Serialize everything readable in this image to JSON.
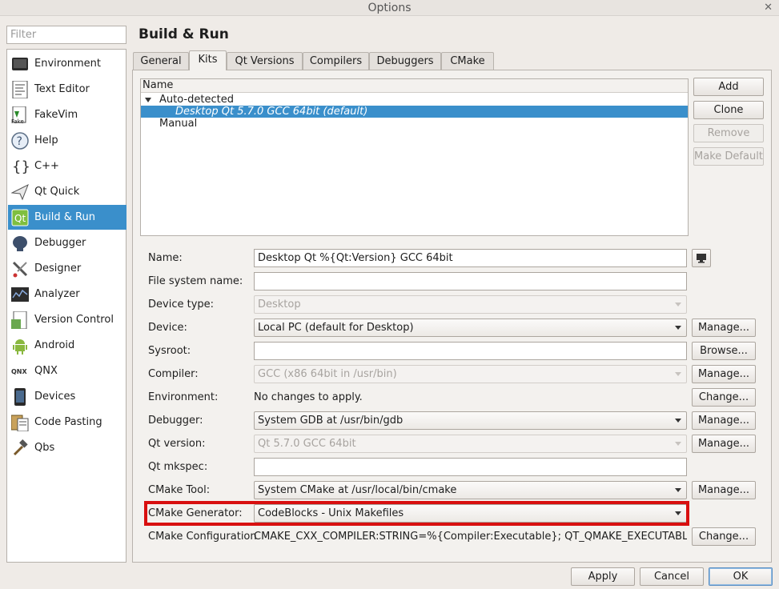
{
  "window": {
    "title": "Options",
    "close": "✕"
  },
  "filter": {
    "placeholder": "Filter",
    "value": ""
  },
  "categories": [
    {
      "label": "Environment",
      "icon": "environment-icon"
    },
    {
      "label": "Text Editor",
      "icon": "text-editor-icon"
    },
    {
      "label": "FakeVim",
      "icon": "fakevim-icon"
    },
    {
      "label": "Help",
      "icon": "help-icon"
    },
    {
      "label": "C++",
      "icon": "cpp-icon"
    },
    {
      "label": "Qt Quick",
      "icon": "qt-quick-icon"
    },
    {
      "label": "Build & Run",
      "icon": "build-run-icon",
      "selected": true
    },
    {
      "label": "Debugger",
      "icon": "debugger-icon"
    },
    {
      "label": "Designer",
      "icon": "designer-icon"
    },
    {
      "label": "Analyzer",
      "icon": "analyzer-icon"
    },
    {
      "label": "Version Control",
      "icon": "version-control-icon"
    },
    {
      "label": "Android",
      "icon": "android-icon"
    },
    {
      "label": "QNX",
      "icon": "qnx-icon"
    },
    {
      "label": "Devices",
      "icon": "devices-icon"
    },
    {
      "label": "Code Pasting",
      "icon": "code-pasting-icon"
    },
    {
      "label": "Qbs",
      "icon": "qbs-icon"
    }
  ],
  "page_title": "Build & Run",
  "tabs": [
    "General",
    "Kits",
    "Qt Versions",
    "Compilers",
    "Debuggers",
    "CMake"
  ],
  "active_tab": "Kits",
  "kit_list": {
    "header": "Name",
    "group_auto": "Auto-detected",
    "auto_kit": "Desktop Qt 5.7.0 GCC 64bit (default)",
    "group_manual": "Manual"
  },
  "kit_buttons": {
    "add": "Add",
    "clone": "Clone",
    "remove": "Remove",
    "make_default": "Make Default"
  },
  "form": {
    "name": {
      "label": "Name:",
      "value": "Desktop Qt %{Qt:Version} GCC 64bit"
    },
    "fs_name": {
      "label": "File system name:",
      "value": ""
    },
    "device_type": {
      "label": "Device type:",
      "value": "Desktop"
    },
    "device": {
      "label": "Device:",
      "value": "Local PC (default for Desktop)",
      "button": "Manage..."
    },
    "sysroot": {
      "label": "Sysroot:",
      "value": "",
      "button": "Browse..."
    },
    "compiler": {
      "label": "Compiler:",
      "value": "GCC (x86 64bit in /usr/bin)",
      "button": "Manage..."
    },
    "environment": {
      "label": "Environment:",
      "value": "No changes to apply.",
      "button": "Change..."
    },
    "debugger": {
      "label": "Debugger:",
      "value": "System GDB at /usr/bin/gdb",
      "button": "Manage..."
    },
    "qt_version": {
      "label": "Qt version:",
      "value": "Qt 5.7.0 GCC 64bit",
      "button": "Manage..."
    },
    "qt_mkspec": {
      "label": "Qt mkspec:",
      "value": ""
    },
    "cmake_tool": {
      "label": "CMake Tool:",
      "value": "System CMake at /usr/local/bin/cmake",
      "button": "Manage..."
    },
    "cmake_generator": {
      "label": "CMake Generator:",
      "value": "CodeBlocks - Unix Makefiles"
    },
    "cmake_config": {
      "label": "CMake Configuration",
      "value": "CMAKE_CXX_COMPILER:STRING=%{Compiler:Executable}; QT_QMAKE_EXECUTABLE:ST...",
      "button": "Change..."
    }
  },
  "footer": {
    "apply": "Apply",
    "cancel": "Cancel",
    "ok": "OK"
  },
  "colors": {
    "selection": "#3a8fcb",
    "highlight_box": "#d80f0f"
  }
}
